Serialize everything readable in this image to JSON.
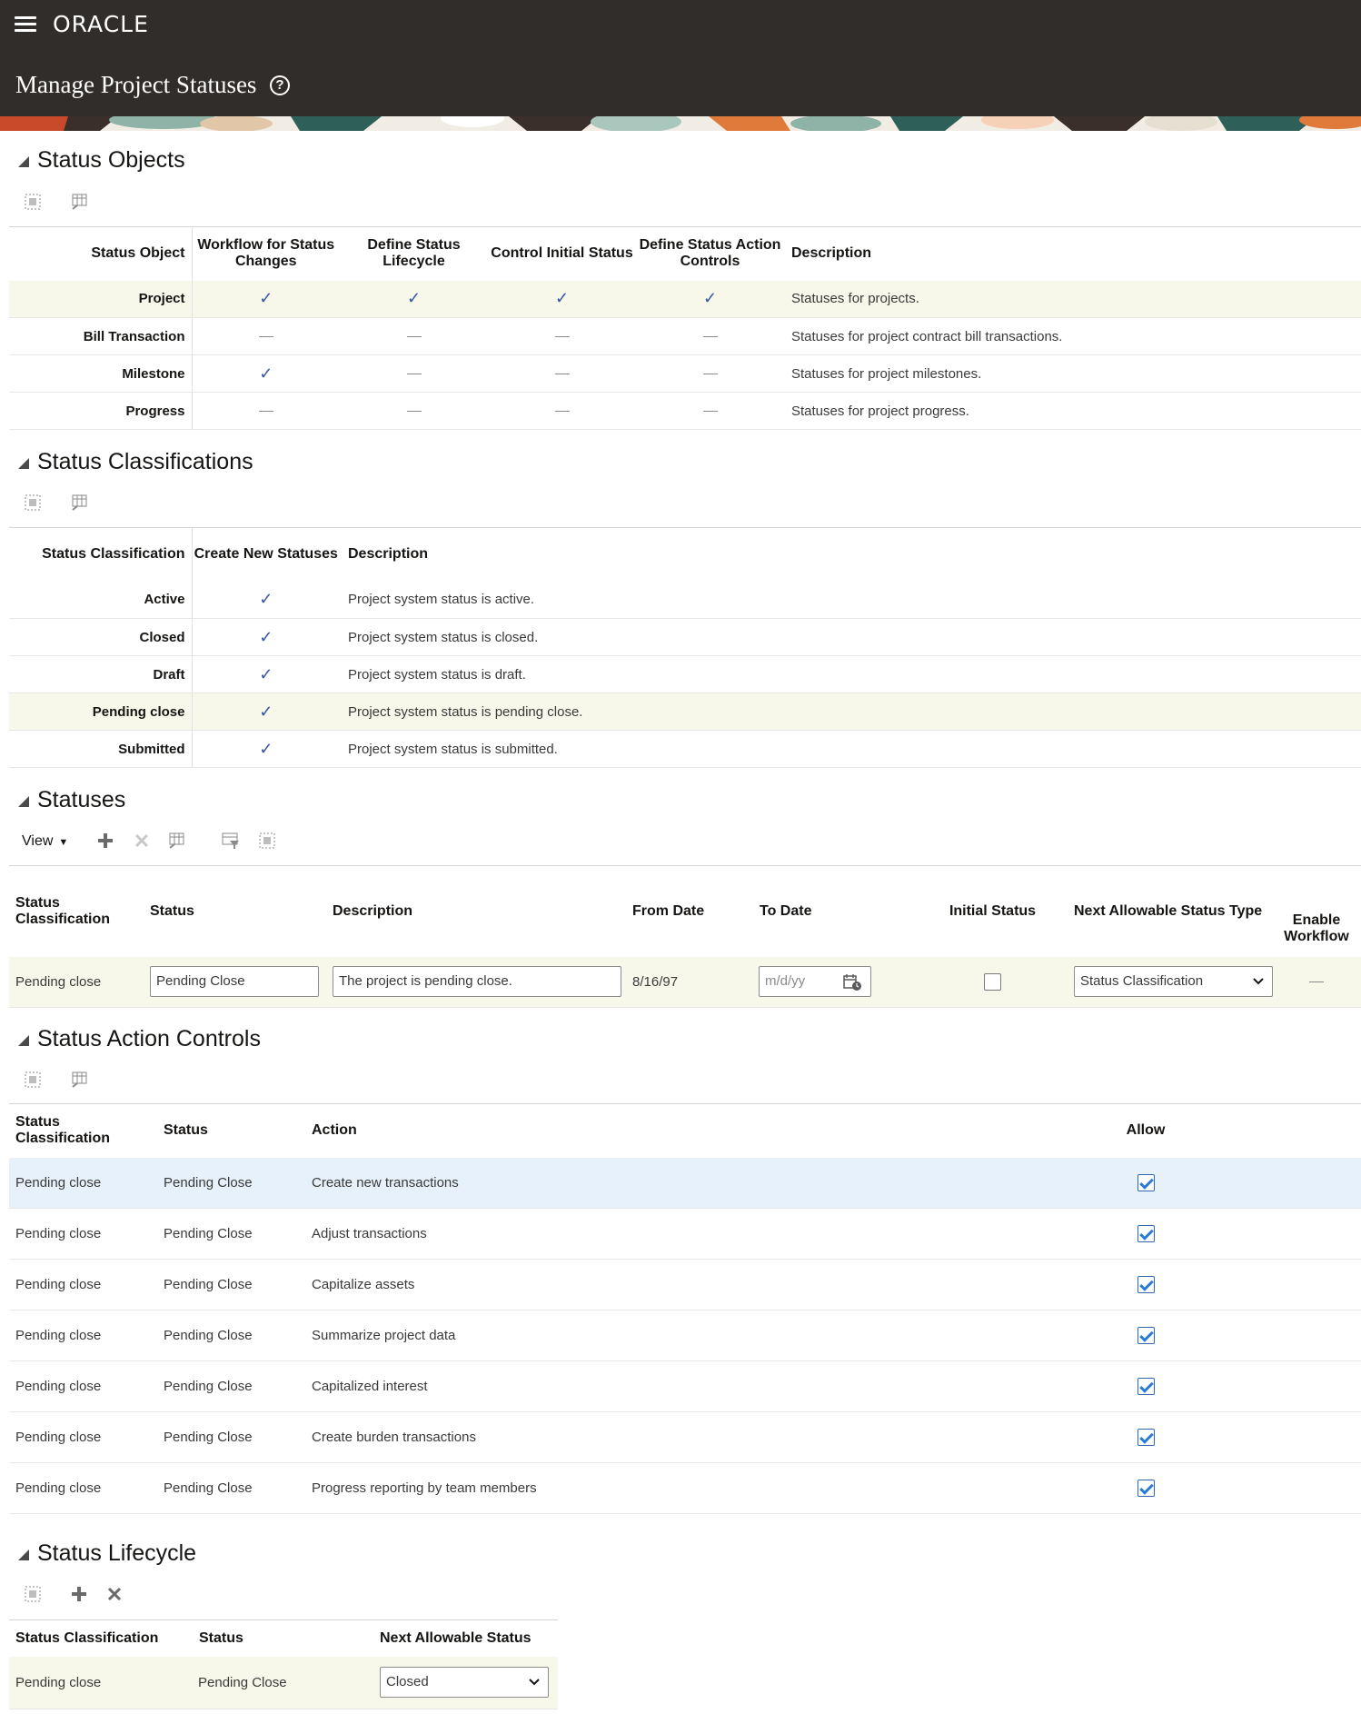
{
  "header": {
    "brand": "ORACLE",
    "title": "Manage Project Statuses",
    "help_glyph": "?"
  },
  "status_objects": {
    "title": "Status Objects",
    "columns": [
      "Status Object",
      "Workflow for Status Changes",
      "Define Status Lifecycle",
      "Control Initial Status",
      "Define Status Action Controls",
      "Description"
    ],
    "rows": [
      {
        "name": "Project",
        "workflow": true,
        "lifecycle": true,
        "initial": true,
        "action": true,
        "description": "Statuses for projects."
      },
      {
        "name": "Bill Transaction",
        "workflow": false,
        "lifecycle": false,
        "initial": false,
        "action": false,
        "description": "Statuses for project contract bill transactions."
      },
      {
        "name": "Milestone",
        "workflow": true,
        "lifecycle": false,
        "initial": false,
        "action": false,
        "description": "Statuses for project milestones."
      },
      {
        "name": "Progress",
        "workflow": false,
        "lifecycle": false,
        "initial": false,
        "action": false,
        "description": "Statuses for project progress."
      }
    ]
  },
  "status_classifications": {
    "title": "Status Classifications",
    "columns": [
      "Status Classification",
      "Create New Statuses",
      "Description"
    ],
    "rows": [
      {
        "name": "Active",
        "create": true,
        "description": "Project system status is active."
      },
      {
        "name": "Closed",
        "create": true,
        "description": "Project system status is closed."
      },
      {
        "name": "Draft",
        "create": true,
        "description": "Project system status is draft."
      },
      {
        "name": "Pending close",
        "create": true,
        "description": "Project system status is pending close."
      },
      {
        "name": "Submitted",
        "create": true,
        "description": "Project system status is submitted."
      }
    ]
  },
  "statuses": {
    "title": "Statuses",
    "view_label": "View",
    "columns": [
      "Status Classification",
      "Status",
      "Description",
      "From Date",
      "To Date",
      "Initial Status",
      "Next Allowable Status Type",
      "Enable Workflow"
    ],
    "row": {
      "classification": "Pending close",
      "status": "Pending Close",
      "description": "The project is pending close.",
      "from_date": "8/16/97",
      "to_date_placeholder": "m/d/yy",
      "initial_status": false,
      "next_type": "Status Classification"
    }
  },
  "status_action_controls": {
    "title": "Status Action Controls",
    "columns": [
      "Status Classification",
      "Status",
      "Action",
      "Allow"
    ],
    "rows": [
      {
        "classification": "Pending close",
        "status": "Pending Close",
        "action": "Create new transactions",
        "allow": true
      },
      {
        "classification": "Pending close",
        "status": "Pending Close",
        "action": "Adjust transactions",
        "allow": true
      },
      {
        "classification": "Pending close",
        "status": "Pending Close",
        "action": "Capitalize assets",
        "allow": true
      },
      {
        "classification": "Pending close",
        "status": "Pending Close",
        "action": "Summarize project data",
        "allow": true
      },
      {
        "classification": "Pending close",
        "status": "Pending Close",
        "action": "Capitalized interest",
        "allow": true
      },
      {
        "classification": "Pending close",
        "status": "Pending Close",
        "action": "Create burden transactions",
        "allow": true
      },
      {
        "classification": "Pending close",
        "status": "Pending Close",
        "action": "Progress reporting by team members",
        "allow": true
      }
    ]
  },
  "status_lifecycle": {
    "title": "Status Lifecycle",
    "columns": [
      "Status Classification",
      "Status",
      "Next Allowable Status"
    ],
    "row": {
      "classification": "Pending close",
      "status": "Pending Close",
      "next_status": "Closed"
    }
  },
  "colors": {
    "header_bg": "#312d2a",
    "selected_row": "#f7f7ea",
    "highlight_row": "#e7f1fb",
    "check": "#3b56a8"
  }
}
